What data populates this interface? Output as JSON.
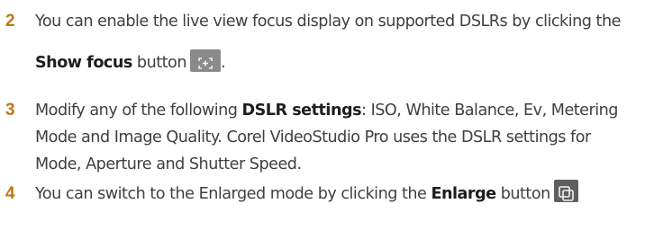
{
  "steps": [
    {
      "number": "2",
      "text_before": "You can enable the live view focus display on supported DSLRs by clicking the ",
      "bold": "Show focus",
      "text_after": " button",
      "trailing": "."
    },
    {
      "number": "3",
      "text_before": "Modify any of the following ",
      "bold": "DSLR settings",
      "text_after": ": ISO, White Balance, Ev, Metering Mode and Image Quality. Corel VideoStudio Pro uses the DSLR settings for Mode, Aperture and Shutter Speed."
    },
    {
      "number": "4",
      "text_before": "You can switch to the Enlarged mode by clicking the ",
      "bold": "Enlarge",
      "text_after": " button"
    }
  ],
  "icons": {
    "show_focus": "show-focus-icon",
    "enlarge": "enlarge-icon"
  },
  "colors": {
    "step_number": "#c0750f",
    "body_text": "#3f3f3f",
    "bold_text": "#1e1e1e",
    "focus_button_bg": "#8a8a8a",
    "enlarge_button_bg": "#5f5f5f"
  }
}
